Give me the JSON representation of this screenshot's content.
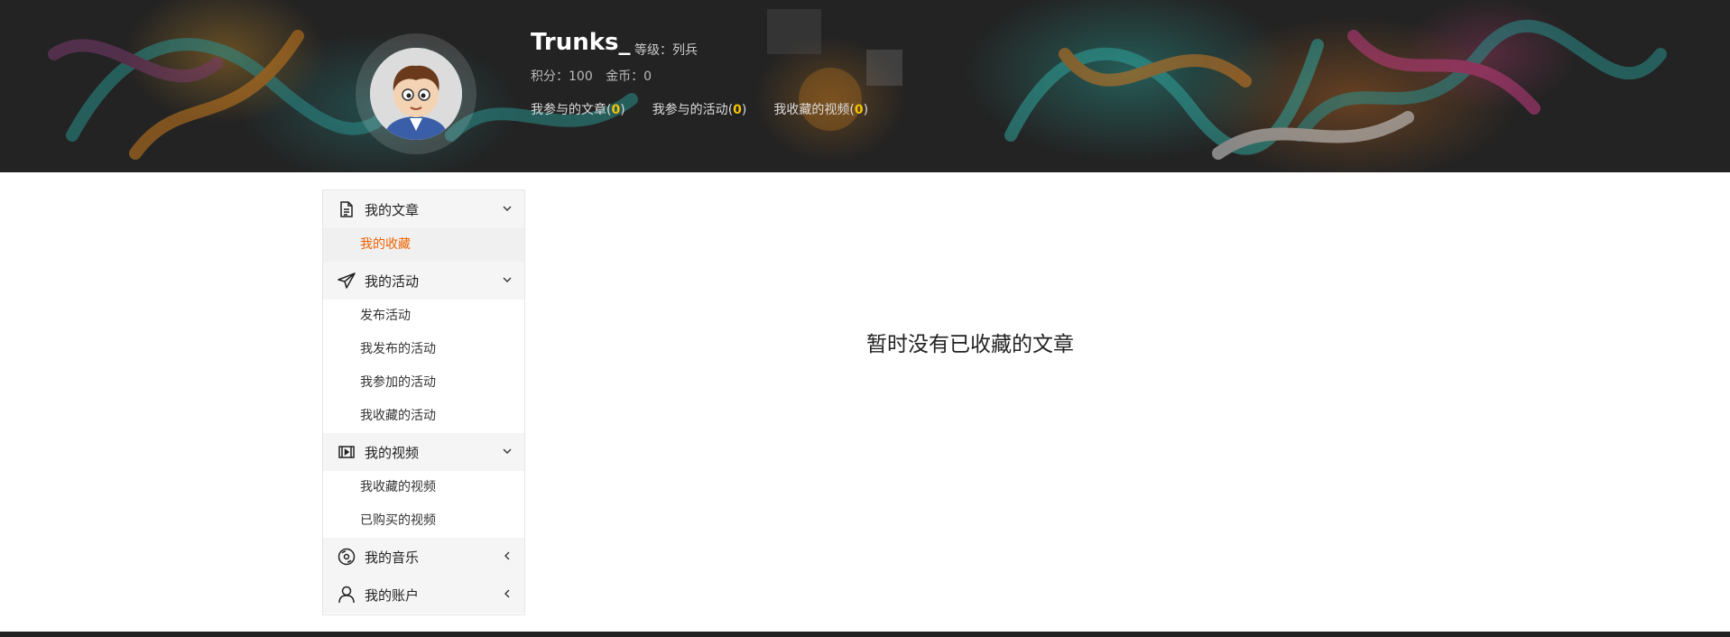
{
  "header": {
    "username": "Trunks_",
    "level": "等级：列兵",
    "points": "积分：100",
    "coins": "金币：0",
    "links": [
      {
        "label": "我参与的文章",
        "count": "0"
      },
      {
        "label": "我参与的活动",
        "count": "0"
      },
      {
        "label": "我收藏的视频",
        "count": "0"
      }
    ]
  },
  "sidebar": {
    "sections": [
      {
        "label": "我的文章",
        "icon": "document-icon",
        "state": "expanded",
        "items": [
          "我的收藏"
        ]
      },
      {
        "label": "我的活动",
        "icon": "paper-plane-icon",
        "state": "expanded",
        "items": [
          "发布活动",
          "我发布的活动",
          "我参加的活动",
          "我收藏的活动"
        ]
      },
      {
        "label": "我的视频",
        "icon": "film-icon",
        "state": "expanded",
        "items": [
          "我收藏的视频",
          "已购买的视频"
        ]
      },
      {
        "label": "我的音乐",
        "icon": "disc-icon",
        "state": "collapsed",
        "items": []
      },
      {
        "label": "我的账户",
        "icon": "user-icon",
        "state": "collapsed",
        "items": []
      }
    ],
    "active_item": "我的收藏"
  },
  "main": {
    "empty_message": "暂时没有已收藏的文章"
  },
  "colors": {
    "active_link": "#f06200",
    "count_highlight": "#f4c400",
    "banner_bg": "#232323"
  }
}
